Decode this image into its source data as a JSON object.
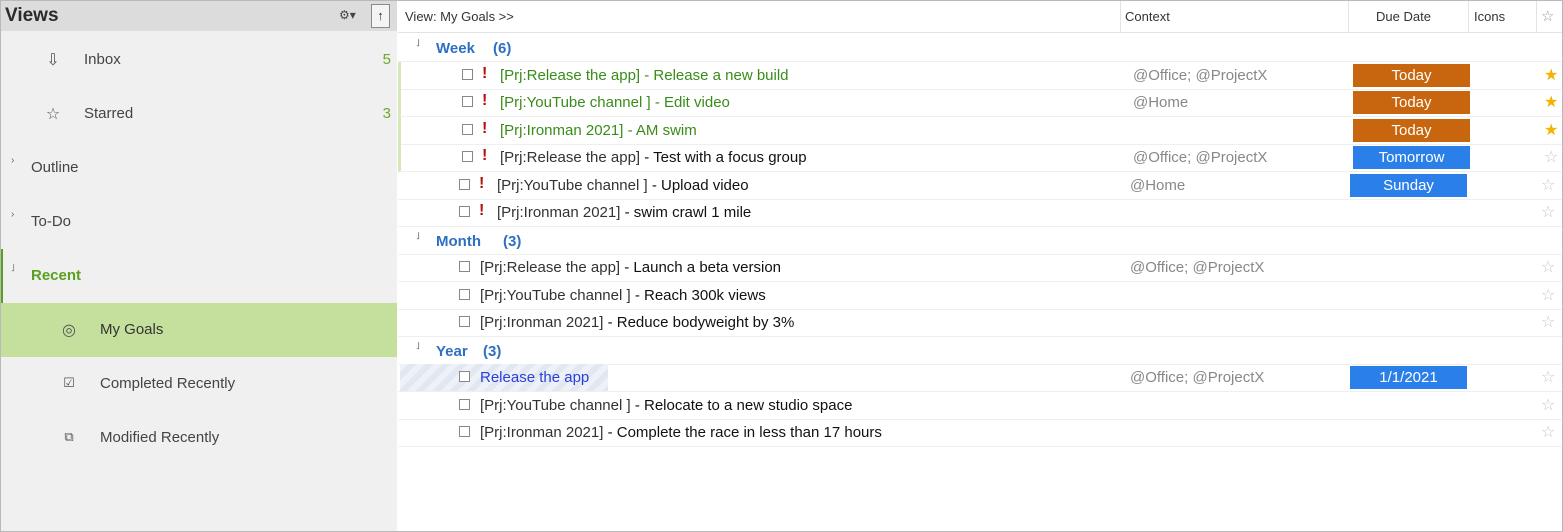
{
  "sidebar": {
    "title": "Views",
    "items": [
      {
        "label": "Inbox",
        "count": "5",
        "icon": "inbox-icon"
      },
      {
        "label": "Starred",
        "count": "3",
        "icon": "star-outline-icon"
      },
      {
        "label": "Outline",
        "icon": "chevron-right-icon"
      },
      {
        "label": "To-Do",
        "icon": "chevron-right-icon"
      },
      {
        "label": "Recent",
        "icon": "chevron-down-icon"
      },
      {
        "label": "My Goals",
        "icon": "target-icon"
      },
      {
        "label": "Completed Recently",
        "icon": "checkbox-icon"
      },
      {
        "label": "Modified Recently",
        "icon": "modified-icon"
      }
    ]
  },
  "main": {
    "view_label": "View: My Goals >>",
    "columns": {
      "context": "Context",
      "due_date": "Due Date",
      "icons": "Icons"
    },
    "groups": [
      {
        "name": "Week",
        "count": "(6)",
        "rows": [
          {
            "prj": "[Prj:Release the app]",
            "task": " - Release a new build",
            "context": "@Office; @ProjectX",
            "due": "Today",
            "due_color": "#c8650f",
            "starred": true,
            "priority": "!",
            "style": "green"
          },
          {
            "prj": "[Prj:YouTube channel ]",
            "task": " - Edit video",
            "context": "@Home",
            "due": "Today",
            "due_color": "#c8650f",
            "starred": true,
            "priority": "!",
            "style": "green"
          },
          {
            "prj": "[Prj:Ironman 2021]",
            "task": " - AM swim",
            "context": "",
            "due": "Today",
            "due_color": "#c8650f",
            "starred": true,
            "priority": "!",
            "style": "green"
          },
          {
            "prj": "[Prj:Release the app]",
            "task": " - Test with a focus group",
            "context": "@Office; @ProjectX",
            "due": "Tomorrow",
            "due_color": "#2a7fe8",
            "starred": false,
            "priority": "!",
            "style": "dark"
          },
          {
            "prj": "[Prj:YouTube channel ]",
            "task": " - Upload video",
            "context": "@Home",
            "due": "Sunday",
            "due_color": "#2a7fe8",
            "starred": false,
            "priority": "!",
            "style": "dark"
          },
          {
            "prj": "[Prj:Ironman 2021]",
            "task": " - swim crawl 1 mile",
            "context": "",
            "due": "",
            "due_color": "",
            "starred": false,
            "priority": "!",
            "style": "dark"
          }
        ]
      },
      {
        "name": "Month",
        "count": "(3)",
        "rows": [
          {
            "prj": "[Prj:Release the app]",
            "task": " - Launch a beta version",
            "context": "@Office; @ProjectX",
            "due": "",
            "due_color": "",
            "starred": false,
            "priority": "",
            "style": "plain"
          },
          {
            "prj": "[Prj:YouTube channel ]",
            "task": " - Reach 300k views",
            "context": "",
            "due": "",
            "due_color": "",
            "starred": false,
            "priority": "",
            "style": "plain"
          },
          {
            "prj": "[Prj:Ironman 2021]",
            "task": " - Reduce bodyweight by 3%",
            "context": "",
            "due": "",
            "due_color": "",
            "starred": false,
            "priority": "",
            "style": "plain"
          }
        ]
      },
      {
        "name": "Year",
        "count": "(3)",
        "rows": [
          {
            "prj": "",
            "task": "Release the app",
            "context": "@Office; @ProjectX",
            "due": "1/1/2021",
            "due_color": "#2a7fe8",
            "starred": false,
            "priority": "",
            "style": "project"
          },
          {
            "prj": "[Prj:YouTube channel ]",
            "task": " - Relocate to a new studio space",
            "context": "",
            "due": "",
            "due_color": "",
            "starred": false,
            "priority": "",
            "style": "plain"
          },
          {
            "prj": "[Prj:Ironman 2021]",
            "task": " - Complete the race in less than 17 hours",
            "context": "",
            "due": "",
            "due_color": "",
            "starred": false,
            "priority": "",
            "style": "plain"
          }
        ]
      }
    ]
  }
}
